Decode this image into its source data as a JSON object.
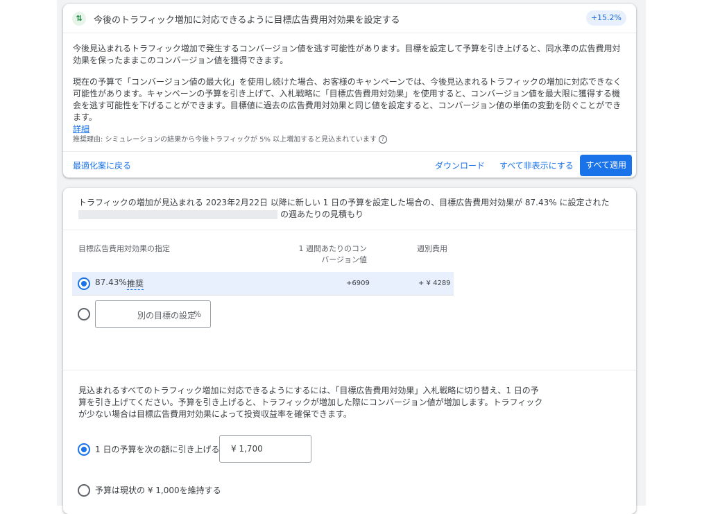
{
  "recommendation": {
    "title": "今後のトラフィック増加に対応できるように目標広告費用対効果を設定する",
    "badge": "+15.2%",
    "para1": "今後見込まれるトラフィック増加で発生するコンバージョン値を逃す可能性があります。目標を設定して予算を引き上げると、同水準の広告費用対効果を保ったままこのコンバージョン値を獲得できます。",
    "para2": "現在の予算で「コンバージョン値の最大化」を使用し続けた場合、お客様のキャンペーンでは、今後見込まれるトラフィックの増加に対応できなく可能性があります。キャンペーンの予算を引き上げて、入札戦略に「目標広告費用対効果」を使用すると、コンバージョン値を最大限に獲得する機会を逃す可能性を下げることができます。目標値に過去の広告費用対効果と同じ値を設定すると、コンバージョン値の単価の変動を防ぐことができます。",
    "details_link": "詳細",
    "reason": "推奨理由: シミュレーションの結果から今後トラフィックが 5% 以上増加すると見込まれています"
  },
  "footer": {
    "back": "最適化案に戻る",
    "download": "ダウンロード",
    "hide_all": "すべて非表示にする",
    "apply_all": "すべて適用"
  },
  "estimate": {
    "intro_line1": "トラフィックの増加が見込まれる 2023年2月22日 以降に新しい 1 日の予算を設定した場合の、目標広告費用対効果が 87.43% に設定された",
    "intro_line2": "の週あたりの見積もり",
    "col_target": "目標広告費用対効果の指定",
    "col_conv_line1": "1 週間あたりのコン",
    "col_conv_line2": "バージョン値",
    "col_cost": "週別費用",
    "row1_value": "87.43%",
    "row1_recommended": "推奨",
    "row1_conv": "+6909",
    "row1_cost": "+ ¥ 4289",
    "custom_placeholder": "別の目標の設定",
    "custom_unit": "%"
  },
  "budget": {
    "para": "見込まれるすべてのトラフィック増加に対応できるようにするには、「目標広告費用対効果」入札戦略に切り替え、1 日の予算を引き上げてください。予算を引き上げると、トラフィックが増加した際にコンバージョン値が増加します。トラフィックが少ない場合は目標広告費用対効果によって投資収益率を確保できます。",
    "raise_label": "1 日の予算を次の額に引き上げる",
    "raise_value": "¥ 1,700",
    "keep_label": "予算は現状の ¥ 1,000を維持する"
  }
}
